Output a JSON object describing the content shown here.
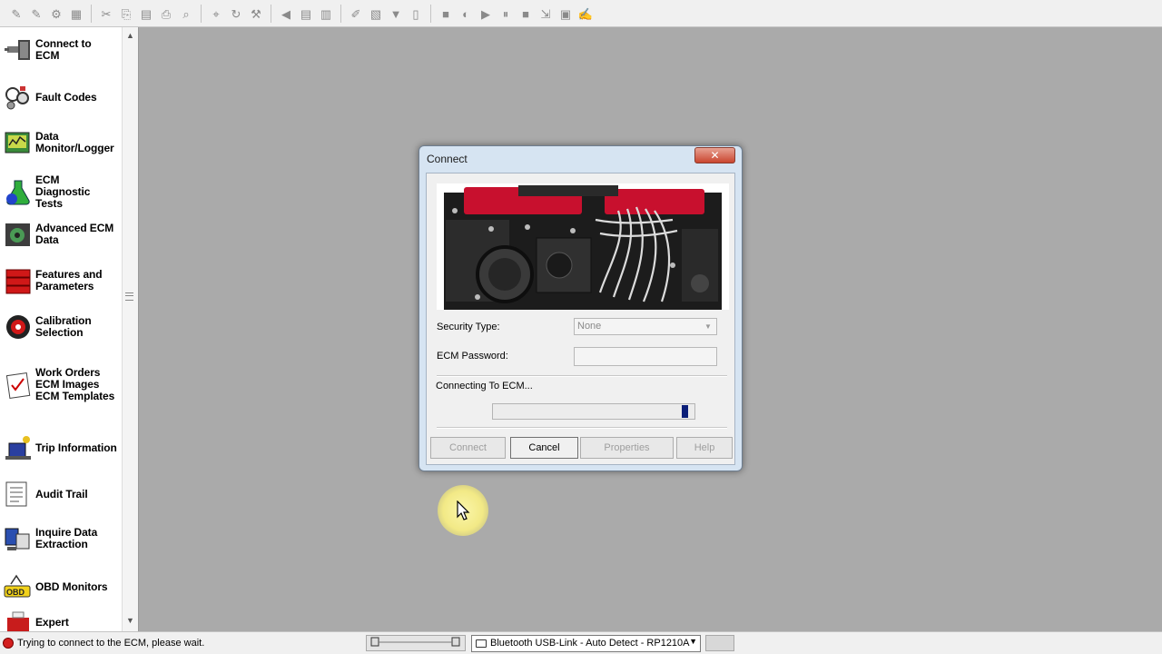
{
  "toolbar": {
    "icons": [
      "new-icon",
      "open-icon",
      "settings-icon",
      "print-preview-icon",
      "cut-icon",
      "copy-icon",
      "paste-icon",
      "print-icon",
      "zoom-icon",
      "find-icon",
      "refresh-icon",
      "tools-icon",
      "announce-icon",
      "export-icon",
      "import-icon",
      "edit-icon",
      "folder-icon",
      "filter-icon",
      "page-icon",
      "record-icon",
      "pause-icon",
      "play-icon",
      "stop-icon",
      "stop2-icon",
      "move-icon",
      "options-icon",
      "notes-icon"
    ]
  },
  "sidebar": {
    "items": [
      {
        "label": "Connect to\nECM",
        "icon": "connect-ecm-icon"
      },
      {
        "label": "Fault Codes",
        "icon": "fault-codes-icon"
      },
      {
        "label": "Data\nMonitor/Logger",
        "icon": "data-monitor-icon"
      },
      {
        "label": "ECM\nDiagnostic\nTests",
        "icon": "diagnostic-tests-icon"
      },
      {
        "label": "Advanced ECM\nData",
        "icon": "advanced-ecm-icon"
      },
      {
        "label": "Features and\nParameters",
        "icon": "features-icon"
      },
      {
        "label": "Calibration\nSelection",
        "icon": "calibration-icon"
      },
      {
        "label": "Work Orders\nECM Images\nECM Templates",
        "icon": "work-orders-icon"
      },
      {
        "label": "Trip Information",
        "icon": "trip-info-icon"
      },
      {
        "label": "Audit Trail",
        "icon": "audit-trail-icon"
      },
      {
        "label": "Inquire Data\nExtraction",
        "icon": "inquire-data-icon"
      },
      {
        "label": "OBD Monitors",
        "icon": "obd-monitors-icon"
      },
      {
        "label": "Expert",
        "icon": "expert-icon"
      }
    ]
  },
  "dialog": {
    "title": "Connect",
    "close_glyph": "✕",
    "security_type_label": "Security Type:",
    "security_type_value": "None",
    "ecm_password_label": "ECM Password:",
    "ecm_password_value": "",
    "status_text": "Connecting To ECM...",
    "progress_fraction": 0.97,
    "buttons": {
      "connect": "Connect",
      "cancel": "Cancel",
      "properties": "Properties",
      "help": "Help"
    },
    "colors": {
      "engine_red": "#c8102e",
      "progress": "#0a1e78"
    }
  },
  "statusbar": {
    "message": "Trying to connect to the ECM, please wait.",
    "adapter": "Bluetooth USB-Link - Auto Detect - RP1210A"
  }
}
